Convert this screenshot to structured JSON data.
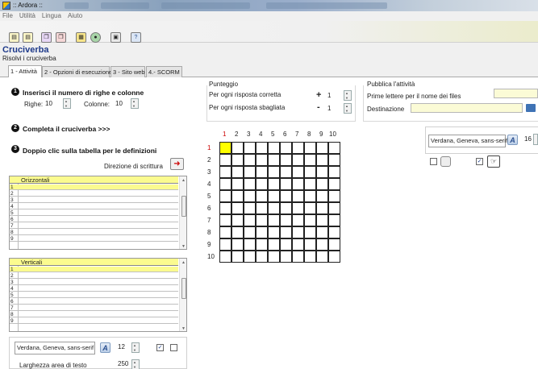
{
  "window": {
    "title": ":: Ardora ::"
  },
  "menu": [
    "File",
    "Utilità",
    "Lingua",
    "Aiuto"
  ],
  "toolbar_icons": [
    "page-icon",
    "page-icon",
    "copy-icon",
    "copy-icon",
    "book-icon",
    "globe-icon",
    "image-icon",
    "help-icon"
  ],
  "header": {
    "title": "Cruciverba",
    "subtitle": "Risolvi i cruciverba"
  },
  "tabs": [
    "1 - Attività",
    "2 - Opzioni di esecuzione",
    "3 - Sito web",
    "4.- SCORM"
  ],
  "steps": {
    "step1": {
      "number": "1",
      "label": "Inserisci il numero di righe e colonne"
    },
    "rows_label": "Righe:",
    "rows_value": "10",
    "cols_label": "Colonne:",
    "cols_value": "10",
    "step2": {
      "number": "2",
      "label": "Completa il cruciverba >>>"
    },
    "step3": {
      "number": "3",
      "label": "Doppio clic sulla tabella per le definizioni"
    },
    "direction_label": "Direzione di scrittura"
  },
  "horizontal_list": {
    "header": "Orizzontali",
    "rows": [
      "1",
      "2",
      "3",
      "4",
      "5",
      "6",
      "7",
      "8",
      "9"
    ]
  },
  "vertical_list": {
    "header": "Verticali",
    "rows": [
      "1",
      "2",
      "3",
      "4",
      "5",
      "6",
      "7",
      "8",
      "9"
    ]
  },
  "score": {
    "title": "Punteggio",
    "correct_label": "Per ogni risposta corretta",
    "correct_sign": "+",
    "correct_value": "1",
    "wrong_label": "Per ogni risposta sbagliata",
    "wrong_sign": "-",
    "wrong_value": "1"
  },
  "publish": {
    "title": "Pubblica l'attività",
    "prefix_label": "Prime lettere per il nome dei files",
    "prefix_value": "",
    "dest_label": "Destinazione",
    "dest_value": ""
  },
  "grid": {
    "cols": [
      "1",
      "2",
      "3",
      "4",
      "5",
      "6",
      "7",
      "8",
      "9",
      "10"
    ],
    "rows": [
      "1",
      "2",
      "3",
      "4",
      "5",
      "6",
      "7",
      "8",
      "9",
      "10"
    ]
  },
  "grid_font": {
    "family": "Verdana, Geneva, sans-serif",
    "size": "16"
  },
  "bottom_font": {
    "family": "Verdana, Geneva, sans-serif",
    "size": "12",
    "width_label": "Larghezza area di testo",
    "width_value": "250"
  },
  "colors": {
    "highlight": "#ffff00",
    "list_header": "#fbfb8f",
    "title": "#1e3a8a",
    "accent_red": "#cc0000"
  }
}
